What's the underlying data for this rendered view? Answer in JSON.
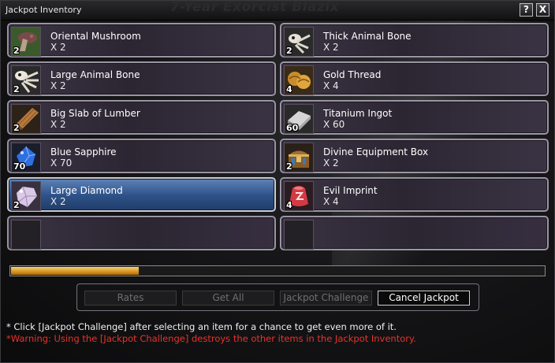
{
  "window": {
    "title": "Jackpot Inventory",
    "background_text": "7-Year Exorcist Blazix",
    "help_label": "?",
    "close_label": "X"
  },
  "items": [
    {
      "name": "Oriental Mushroom",
      "qty": "X 2",
      "count": "2",
      "icon": "mushroom-icon",
      "selected": false
    },
    {
      "name": "Thick Animal Bone",
      "qty": "X 2",
      "count": "2",
      "icon": "bone-icon",
      "selected": false
    },
    {
      "name": "Large Animal Bone",
      "qty": "X 2",
      "count": "2",
      "icon": "bone-icon",
      "selected": false
    },
    {
      "name": "Gold Thread",
      "qty": "X 4",
      "count": "4",
      "icon": "gold-thread-icon",
      "selected": false
    },
    {
      "name": "Big Slab of Lumber",
      "qty": "X 2",
      "count": "2",
      "icon": "lumber-icon",
      "selected": false
    },
    {
      "name": "Titanium Ingot",
      "qty": "X 60",
      "count": "60",
      "icon": "ingot-icon",
      "selected": false
    },
    {
      "name": "Blue Sapphire",
      "qty": "X 70",
      "count": "70",
      "icon": "sapphire-icon",
      "selected": false
    },
    {
      "name": "Divine Equipment Box",
      "qty": "X 2",
      "count": "2",
      "icon": "chest-icon",
      "selected": false
    },
    {
      "name": "Large Diamond",
      "qty": "X 2",
      "count": "2",
      "icon": "diamond-icon",
      "selected": true
    },
    {
      "name": "Evil Imprint",
      "qty": "X 4",
      "count": "4",
      "icon": "imprint-icon",
      "selected": false
    }
  ],
  "progress": {
    "fraction": 0.24
  },
  "buttons": {
    "rates": "Rates",
    "get_all": "Get All",
    "jackpot_challenge": "Jackpot Challenge",
    "cancel_jackpot": "Cancel Jackpot"
  },
  "messages": {
    "hint": "* Click [Jackpot Challenge] after selecting an item for a chance to get even more of it.",
    "warning": "*Warning: Using the [Jackpot Challenge] destroys the other items in the Jackpot Inventory."
  },
  "colors": {
    "selected_slot": "#2d5187",
    "progress_fill": "#d8951c",
    "warning_text": "#e8322a"
  }
}
